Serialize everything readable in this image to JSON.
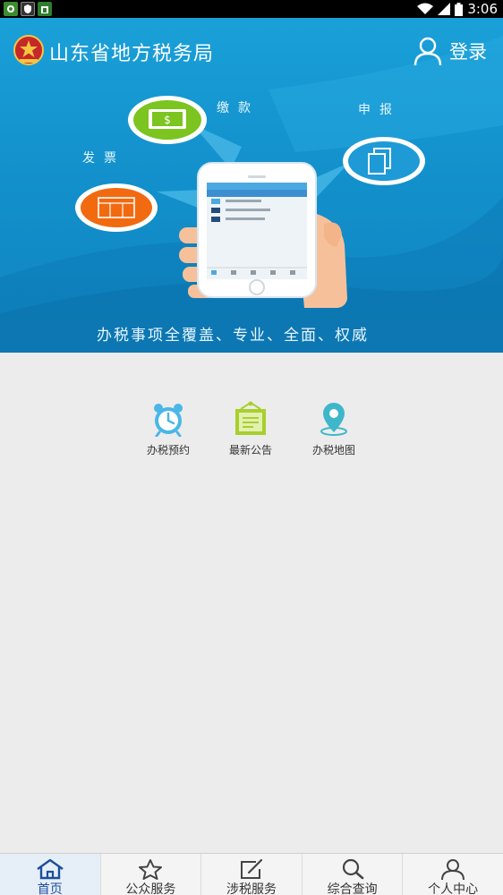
{
  "status_bar": {
    "time": "3:06",
    "icons": [
      "app-notification-icon",
      "shield-notification-icon",
      "store-notification-icon",
      "wifi-icon",
      "signal-icon",
      "battery-icon"
    ]
  },
  "header": {
    "title": "山东省地方税务局",
    "login_label": "登录"
  },
  "banner": {
    "feature_payment": "缴款",
    "feature_declare": "申报",
    "feature_invoice": "发票",
    "slogan": "办税事项全覆盖、专业、全面、权威",
    "colors": {
      "green": "#7cc41f",
      "orange": "#f26a10",
      "blue": "#1e9ad6"
    }
  },
  "quick_entries": [
    {
      "label": "办税预约",
      "icon": "alarm-clock-icon",
      "color": "#4ab7e6"
    },
    {
      "label": "最新公告",
      "icon": "notice-board-icon",
      "color": "#a8cf2e"
    },
    {
      "label": "办税地图",
      "icon": "map-pin-icon",
      "color": "#3fb6c9"
    }
  ],
  "bottom_nav": [
    {
      "label": "首页",
      "icon": "home-icon",
      "active": true
    },
    {
      "label": "公众服务",
      "icon": "star-icon",
      "active": false
    },
    {
      "label": "涉税服务",
      "icon": "edit-icon",
      "active": false
    },
    {
      "label": "综合查询",
      "icon": "search-icon",
      "active": false
    },
    {
      "label": "个人中心",
      "icon": "person-icon",
      "active": false
    }
  ],
  "accent_color": "#1a4f9c"
}
